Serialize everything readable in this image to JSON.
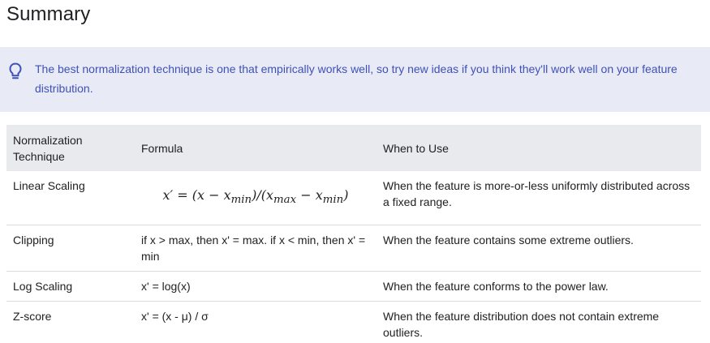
{
  "heading": "Summary",
  "callout": {
    "icon": "lightbulb-icon",
    "accent_color": "#3f51b5",
    "background_color": "#e8eaf6",
    "text": "The best normalization technique is one that empirically works well, so try new ideas if you think they'll work well on your feature distribution."
  },
  "table": {
    "headers": {
      "technique": "Normalization Technique",
      "formula": "Formula",
      "when": "When to Use"
    },
    "rows": [
      {
        "technique": "Linear Scaling",
        "formula": "x′ = (x − xmin)/(xmax − xmin)",
        "when": "When the feature is more-or-less uniformly distributed across a fixed range."
      },
      {
        "technique": "Clipping",
        "formula": "if x > max, then x' = max. if x < min, then x' = min",
        "when": "When the feature contains some extreme outliers."
      },
      {
        "technique": "Log Scaling",
        "formula": "x' = log(x)",
        "when": "When the feature conforms to the power law."
      },
      {
        "technique": "Z-score",
        "formula": "x' = (x - μ) / σ",
        "when": "When the feature distribution does not contain extreme outliers."
      }
    ]
  }
}
